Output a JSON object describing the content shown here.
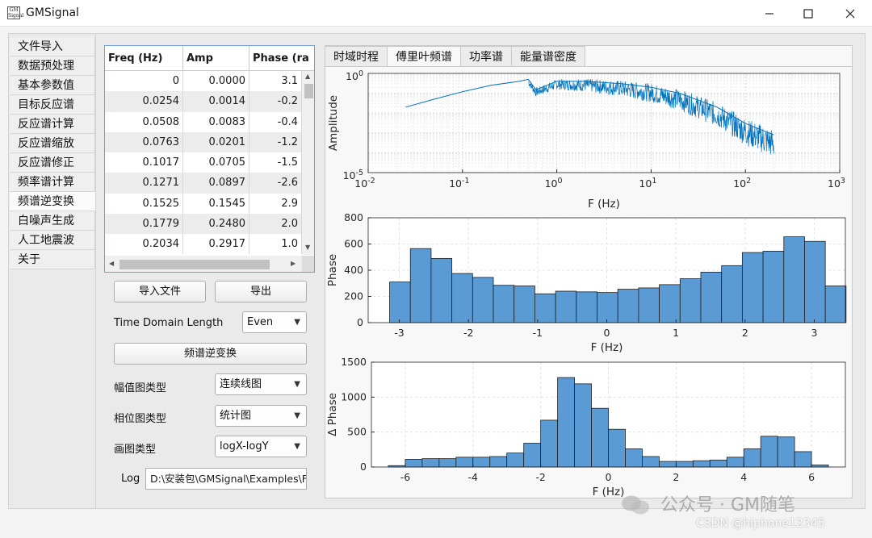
{
  "window": {
    "title": "GMSignal",
    "icon_text": "GM Signal"
  },
  "nav": {
    "items": [
      "文件导入",
      "数据预处理",
      "基本参数值",
      "目标反应谱",
      "反应谱计算",
      "反应谱缩放",
      "反应谱修正",
      "频率谱计算",
      "频谱逆变换",
      "白噪声生成",
      "人工地震波",
      "关于"
    ],
    "selected": "频谱逆变换"
  },
  "table": {
    "columns": [
      "Freq (Hz)",
      "Amp",
      "Phase (ra"
    ],
    "rows": [
      [
        "0",
        "0.0000",
        "3.1"
      ],
      [
        "0.0254",
        "0.0014",
        "-0.2"
      ],
      [
        "0.0508",
        "0.0083",
        "-0.4"
      ],
      [
        "0.0763",
        "0.0201",
        "-1.2"
      ],
      [
        "0.1017",
        "0.0705",
        "-1.5"
      ],
      [
        "0.1271",
        "0.0897",
        "-2.6"
      ],
      [
        "0.1525",
        "0.1545",
        "2.9"
      ],
      [
        "0.1779",
        "0.2480",
        "2.0"
      ],
      [
        "0.2034",
        "0.2917",
        "1.0"
      ]
    ]
  },
  "controls": {
    "import_label": "导入文件",
    "export_label": "导出",
    "time_domain_label": "Time Domain Length",
    "time_domain_value": "Even",
    "inverse_button": "频谱逆变换",
    "amp_plot_label": "幅值图类型",
    "amp_plot_value": "连续线图",
    "phase_plot_label": "相位图类型",
    "phase_plot_value": "统计图",
    "plot_type_label": "画图类型",
    "plot_type_value": "logX-logY",
    "log_label": "Log",
    "log_value": "D:\\安装包\\GMSignal\\Examples\\F"
  },
  "tabs": [
    {
      "label": "时域时程",
      "active": false
    },
    {
      "label": "傅里叶频谱",
      "active": true
    },
    {
      "label": "功率谱",
      "active": false
    },
    {
      "label": "能量谱密度",
      "active": false
    }
  ],
  "colors": {
    "line": "#0072BD",
    "bar": "#5B9BD5",
    "bar_edge": "#1f1f1f"
  },
  "chart_data": [
    {
      "type": "line",
      "xlabel": "F (Hz)",
      "ylabel": "Amplitude",
      "xscale": "log",
      "yscale": "log",
      "xlim": [
        0.01,
        1000
      ],
      "ylim": [
        1e-05,
        1
      ],
      "xticks": [
        0.01,
        0.1,
        1,
        10,
        100,
        1000
      ],
      "xtick_labels": [
        "10-2",
        "10-1",
        "100",
        "101",
        "102",
        "103"
      ],
      "yticks": [
        1e-05,
        1
      ],
      "ytick_labels": [
        "10-5",
        "100"
      ],
      "grid": true,
      "x": [
        0.025,
        0.05,
        0.1,
        0.2,
        0.4,
        0.5,
        0.6,
        1,
        2,
        5,
        10,
        20,
        50,
        100,
        200
      ],
      "y": [
        0.02,
        0.05,
        0.12,
        0.25,
        0.4,
        0.5,
        0.15,
        0.4,
        0.4,
        0.3,
        0.2,
        0.1,
        0.02,
        0.003,
        0.0008
      ]
    },
    {
      "type": "bar",
      "xlabel": "F (Hz)",
      "ylabel": "Phase",
      "xlim": [
        -3.45,
        3.45
      ],
      "ylim": [
        0,
        800
      ],
      "xticks": [
        -3,
        -2,
        -1,
        0,
        1,
        2,
        3
      ],
      "yticks": [
        0,
        200,
        400,
        600,
        800
      ],
      "grid": true,
      "bin_start": -3.14,
      "bin_width": 0.3,
      "values": [
        310,
        565,
        490,
        375,
        345,
        285,
        280,
        220,
        240,
        235,
        230,
        255,
        265,
        290,
        335,
        385,
        435,
        535,
        545,
        655,
        620,
        280
      ]
    },
    {
      "type": "bar",
      "xlabel": "F (Hz)",
      "ylabel": "Δ Phase",
      "xlim": [
        -7,
        7
      ],
      "ylim": [
        0,
        1500
      ],
      "xticks": [
        -6,
        -4,
        -2,
        0,
        2,
        4,
        6
      ],
      "yticks": [
        0,
        500,
        1000,
        1500
      ],
      "grid": true,
      "bin_start": -6.5,
      "bin_width": 0.5,
      "values": [
        20,
        110,
        120,
        120,
        140,
        140,
        150,
        200,
        340,
        670,
        1280,
        1190,
        840,
        540,
        260,
        150,
        80,
        80,
        90,
        100,
        140,
        260,
        440,
        430,
        220,
        30
      ]
    }
  ],
  "watermark": {
    "text": "公众号 · GM随笔",
    "csdn": "CSDN @hiphone12345"
  }
}
